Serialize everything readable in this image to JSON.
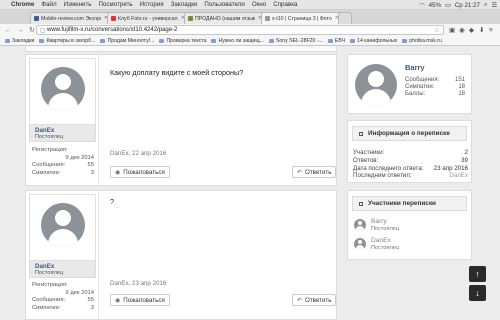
{
  "menubar": {
    "app": "Chrome",
    "items": [
      "Файл",
      "Изменить",
      "Посмотреть",
      "История",
      "Закладки",
      "Пользователи",
      "Окно",
      "Справка"
    ],
    "battery": "45%",
    "clock": "Ср 21:27"
  },
  "tabs": [
    {
      "title": "Mobile-review.com Экспресс..."
    },
    {
      "title": "Клуб Foto.ru - универсал..."
    },
    {
      "title": "ПРОДАНО (нашим отзывам..."
    },
    {
      "title": "x-t10 | Страница 3 | Фото..."
    }
  ],
  "address": {
    "url": "www.fujifilm-x.ru/conversations/xt10.4242/page-2"
  },
  "bookmarks": [
    "Закладки",
    "Квартиры в загорб...",
    "Продам Минолту!...",
    "Проверка текста",
    "Нужно ли защищ...",
    "Sony SEL-28F20 -...",
    "ЕВЧ",
    "14 канифольных",
    "photka.msk.ru"
  ],
  "posts": [
    {
      "username": "DanEx",
      "role": "Постоялец",
      "registered_label": "Регистрация:",
      "registered": "9 дек 2014",
      "messages_label": "Сообщения:",
      "messages": "55",
      "likes_label": "Симпатии:",
      "likes": "3",
      "text": "Какую доплату видите с моей стороны?",
      "date": "DanEx, 22 апр 2016",
      "complain": "Пожаловаться",
      "reply": "Ответить"
    },
    {
      "username": "DanEx",
      "role": "Постоялец",
      "registered_label": "Регистрация:",
      "registered": "9 дек 2014",
      "messages_label": "Сообщения:",
      "messages": "55",
      "likes_label": "Симпатии:",
      "likes": "3",
      "text": "?",
      "date": "DanEx, 23 апр 2016",
      "complain": "Пожаловаться",
      "reply": "Ответить"
    }
  ],
  "profile": {
    "name": "Barry",
    "messages_label": "Сообщения:",
    "messages": "151",
    "likes_label": "Симпатии:",
    "likes": "18",
    "points_label": "Баллы:",
    "points": "18"
  },
  "conversation_info": {
    "title": "Информация о переписке",
    "participants_label": "Участники:",
    "participants": "2",
    "replies_label": "Ответов:",
    "replies": "39",
    "last_date_label": "Дата последнего ответа:",
    "last_date": "23 апр 2016",
    "last_replier_label": "Последним ответил:",
    "last_replier": "DanEx"
  },
  "participants_box": {
    "title": "Участники переписки",
    "members": [
      {
        "name": "Barry",
        "role": "Постоялец"
      },
      {
        "name": "DanEx",
        "role": "Постоялец"
      }
    ]
  },
  "colors": {
    "accent": "#3a5a7a",
    "page_bg": "#ececec",
    "scroll_buttons": "#2a2a2a"
  }
}
